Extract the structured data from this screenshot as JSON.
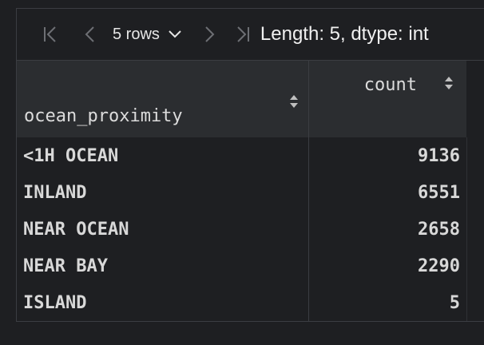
{
  "toolbar": {
    "rows_label": "5 rows",
    "length_info": "Length: 5, dtype: int"
  },
  "table": {
    "columns": [
      "ocean_proximity",
      "count"
    ],
    "rows": [
      {
        "label": "<1H OCEAN",
        "count": "9136"
      },
      {
        "label": "INLAND",
        "count": "6551"
      },
      {
        "label": "NEAR OCEAN",
        "count": "2658"
      },
      {
        "label": "NEAR BAY",
        "count": "2290"
      },
      {
        "label": "ISLAND",
        "count": "5"
      }
    ]
  },
  "icons": {
    "first": "first-page-icon",
    "prev": "prev-page-icon",
    "dropdown": "chevron-down-icon",
    "next": "next-page-icon",
    "last": "last-page-icon",
    "sort": "sort-icon"
  },
  "colors": {
    "background": "#1e1f22",
    "header": "#2b2d30",
    "border": "#3b3d42",
    "muted_icon": "#6d6f74"
  }
}
